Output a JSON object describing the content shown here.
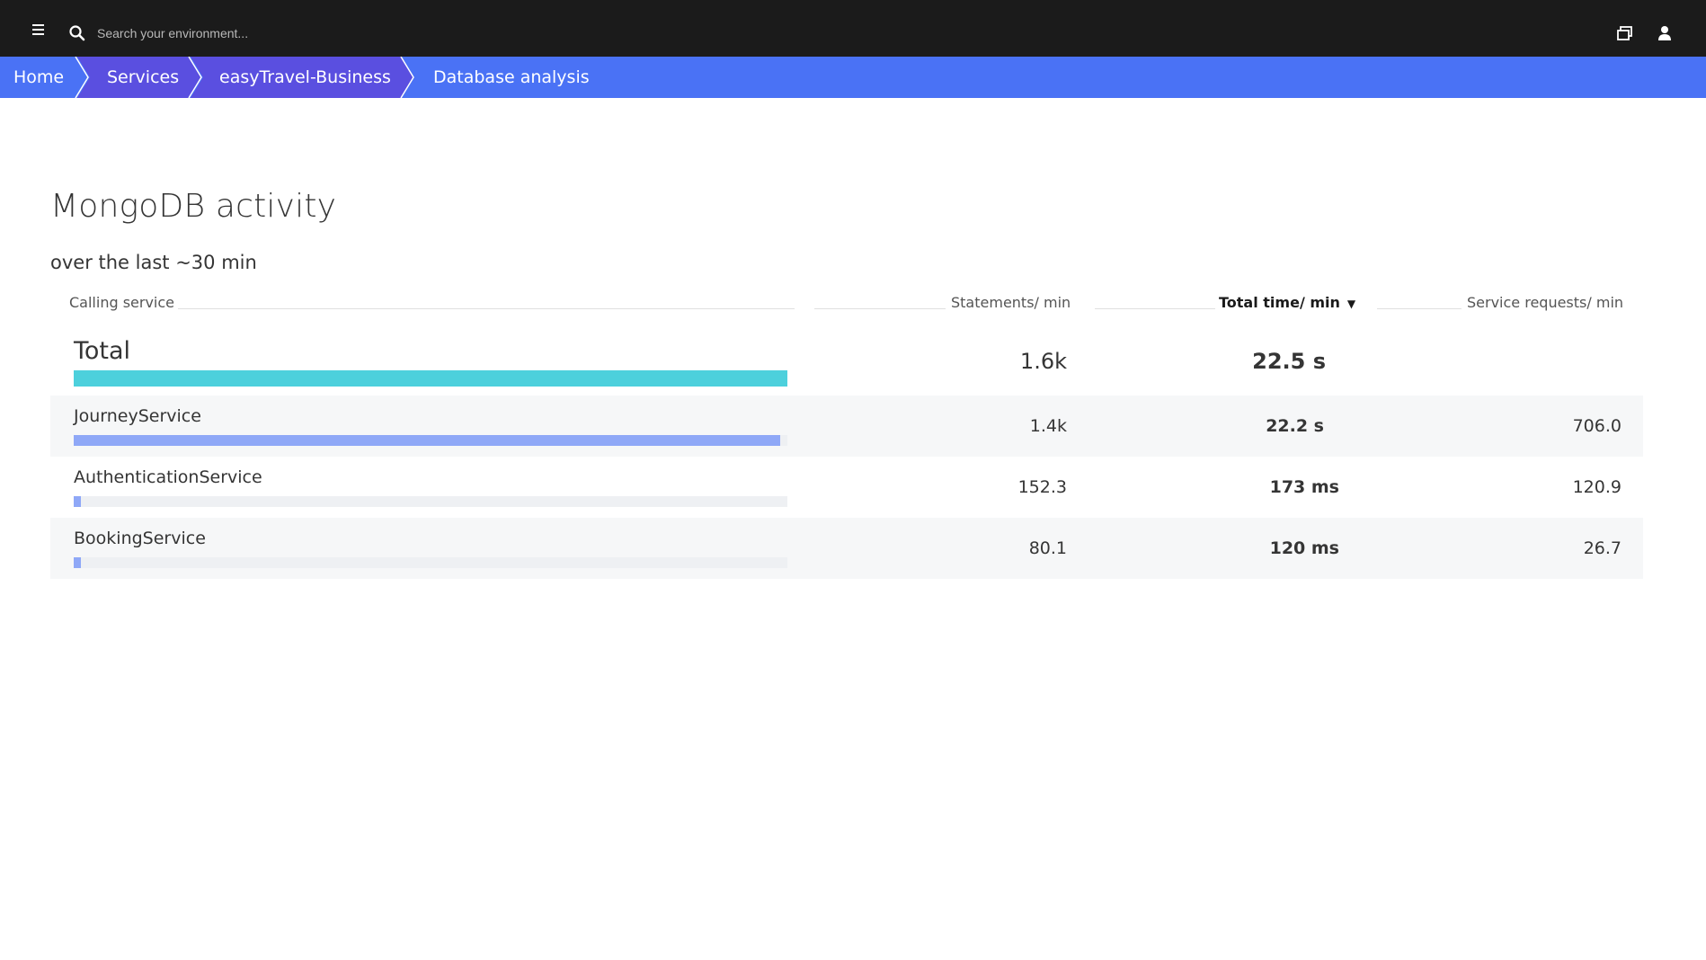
{
  "topbar": {
    "search_placeholder": "Search your environment...",
    "icons": [
      "menu-icon",
      "search-icon",
      "windows-icon",
      "user-icon"
    ]
  },
  "breadcrumb": {
    "items": [
      {
        "label": "Home"
      },
      {
        "label": "Services"
      },
      {
        "label": "easyTravel-Business"
      },
      {
        "label": "Database analysis"
      }
    ]
  },
  "page": {
    "title": "MongoDB activity",
    "subtitle": "over the last ~30 min"
  },
  "table": {
    "columns": {
      "calling_service": "Calling service",
      "statements": "Statements/ min",
      "total_time": "Total time/ min",
      "sort_indicator": "▼",
      "service_requests": "Service requests/ min"
    },
    "total": {
      "name": "Total",
      "statements": "1.6k",
      "total_time": "22.5 s",
      "service_requests": "",
      "bar_fraction": 1.0,
      "bar_color": "#4dd0dc"
    },
    "rows": [
      {
        "name": "JourneyService",
        "statements": "1.4k",
        "total_time": "22.2 s",
        "service_requests": "706.0",
        "bar_fraction": 0.99,
        "bar_color": "#8fa8f7"
      },
      {
        "name": "AuthenticationService",
        "statements": "152.3",
        "total_time": "173 ms",
        "service_requests": "120.9",
        "bar_fraction": 0.008,
        "bar_color": "#8fa8f7"
      },
      {
        "name": "BookingService",
        "statements": "80.1",
        "total_time": "120 ms",
        "service_requests": "26.7",
        "bar_fraction": 0.005,
        "bar_color": "#8fa8f7"
      }
    ]
  },
  "colors": {
    "topbar_bg": "#1b1b1b",
    "breadcrumb_bg": "#4a72f5",
    "breadcrumb_active": "#5a4fe0",
    "total_bar": "#4dd0dc",
    "row_bar": "#8fa8f7",
    "row_stripe": "#f6f7f8"
  }
}
